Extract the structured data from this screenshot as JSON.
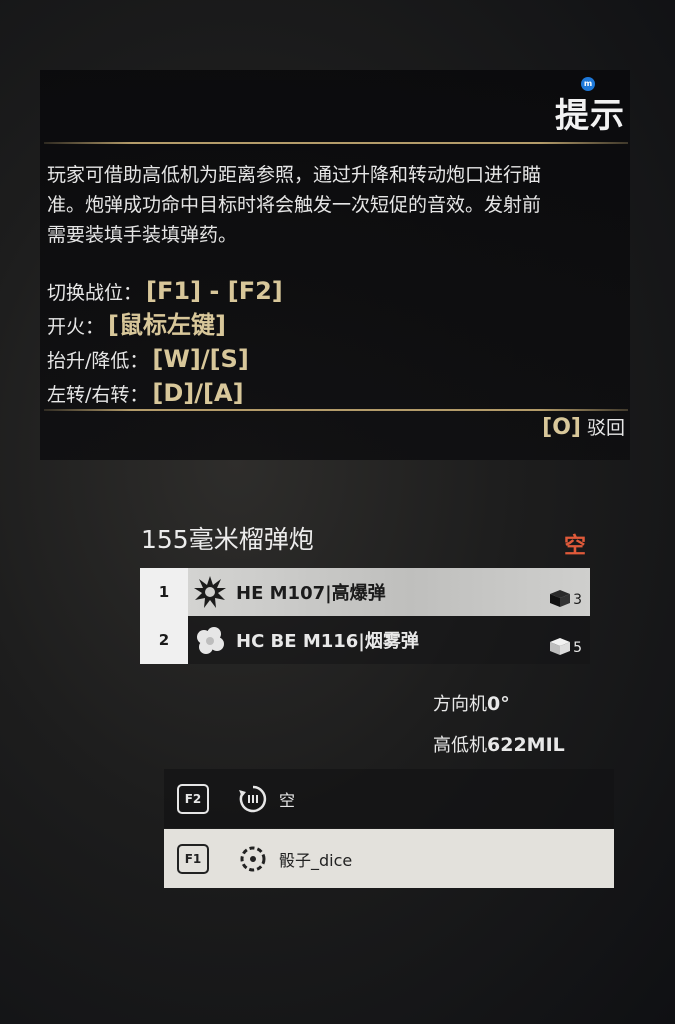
{
  "hint": {
    "badge": "m",
    "title": "提示",
    "body_line1": "玩家可借助高低机为距离参照，通过升降和转动炮口进行瞄",
    "body_line2": "准。炮弹成功命中目标时将会触发一次短促的音效。发射前",
    "body_line3": "需要装填手装填弹药。",
    "controls": [
      {
        "label": "切换战位：",
        "key": "[F1] - [F2]"
      },
      {
        "label": "开火：",
        "key": "[鼠标左键]"
      },
      {
        "label": "抬升/降低：",
        "key": "[W]/[S]"
      },
      {
        "label": "左转/右转：",
        "key": "[D]/[A]"
      }
    ],
    "dismiss_key": "[O]",
    "dismiss_label": "驳回"
  },
  "weapon": {
    "name": "155毫米榴弹炮",
    "status": "空",
    "status_color": "#e05a3a",
    "ammo": [
      {
        "index": "1",
        "icon": "explosion-icon",
        "label": "HE M107|高爆弹",
        "count": "3",
        "selected": true
      },
      {
        "index": "2",
        "icon": "smoke-icon",
        "label": "HC BE M116|烟雾弹",
        "count": "5",
        "selected": false
      }
    ]
  },
  "readouts": {
    "traverse_label": "方向机",
    "traverse_value": "0°",
    "elevation_label": "高低机",
    "elevation_value": "622MIL"
  },
  "slots": [
    {
      "key": "F2",
      "icon": "reload-icon",
      "label": "空"
    },
    {
      "key": "F1",
      "icon": "gunner-icon",
      "label": "骰子_dice"
    }
  ],
  "colors": {
    "accent_gold": "#b49c6a",
    "key_color": "#d8c79a"
  }
}
